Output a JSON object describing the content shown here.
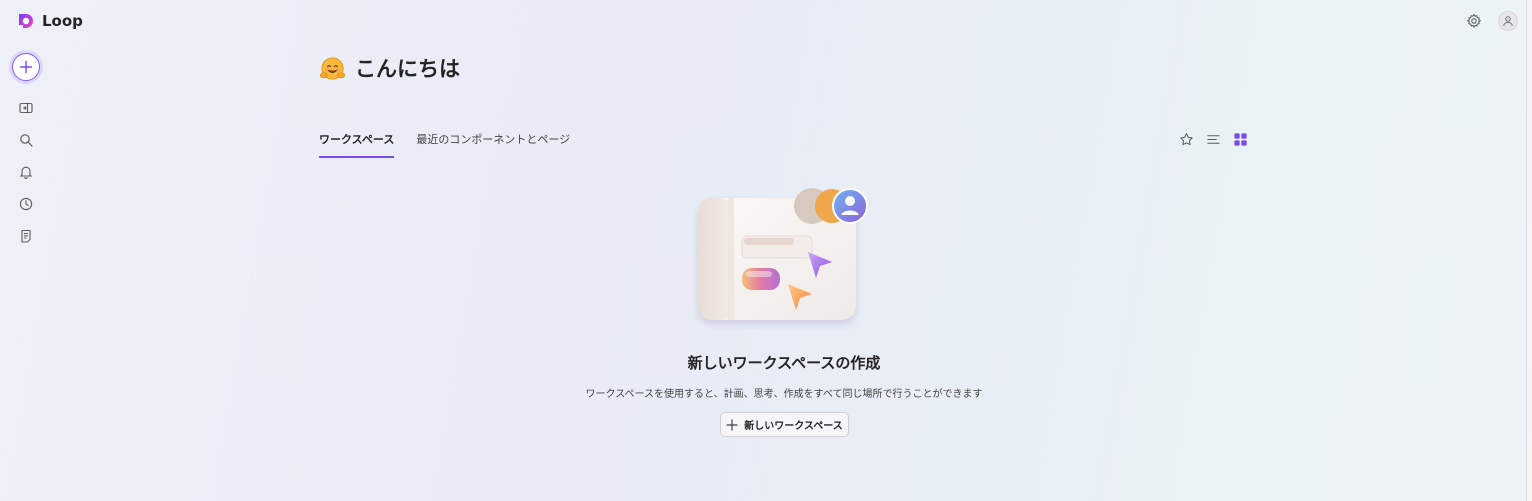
{
  "app": {
    "name": "Loop"
  },
  "header": {
    "settings_icon": "gear-icon",
    "account_icon": "person-icon"
  },
  "rail": {
    "new_button_icon": "plus-icon",
    "items": [
      {
        "name": "sidebar-toggle",
        "icon": "panel-icon"
      },
      {
        "name": "search",
        "icon": "search-icon"
      },
      {
        "name": "notifications",
        "icon": "bell-icon"
      },
      {
        "name": "recent",
        "icon": "clock-icon"
      },
      {
        "name": "notes",
        "icon": "document-icon"
      }
    ]
  },
  "greeting": {
    "emoji": "🤗",
    "text": "こんにちは"
  },
  "tabs": [
    {
      "label": "ワークスペース",
      "active": true
    },
    {
      "label": "最近のコンポーネントとページ",
      "active": false
    }
  ],
  "view_tools": {
    "favorite_icon": "star-icon",
    "list_icon": "list-icon",
    "grid_icon": "grid-icon",
    "accent": "#7a4be8"
  },
  "empty_state": {
    "title": "新しいワークスペースの作成",
    "description": "ワークスペースを使用すると、計画、思考、作成をすべて同じ場所で行うことができます",
    "button_label": "新しいワークスペース"
  },
  "colors": {
    "accent": "#7a4be8",
    "background": "#eaedf7"
  }
}
